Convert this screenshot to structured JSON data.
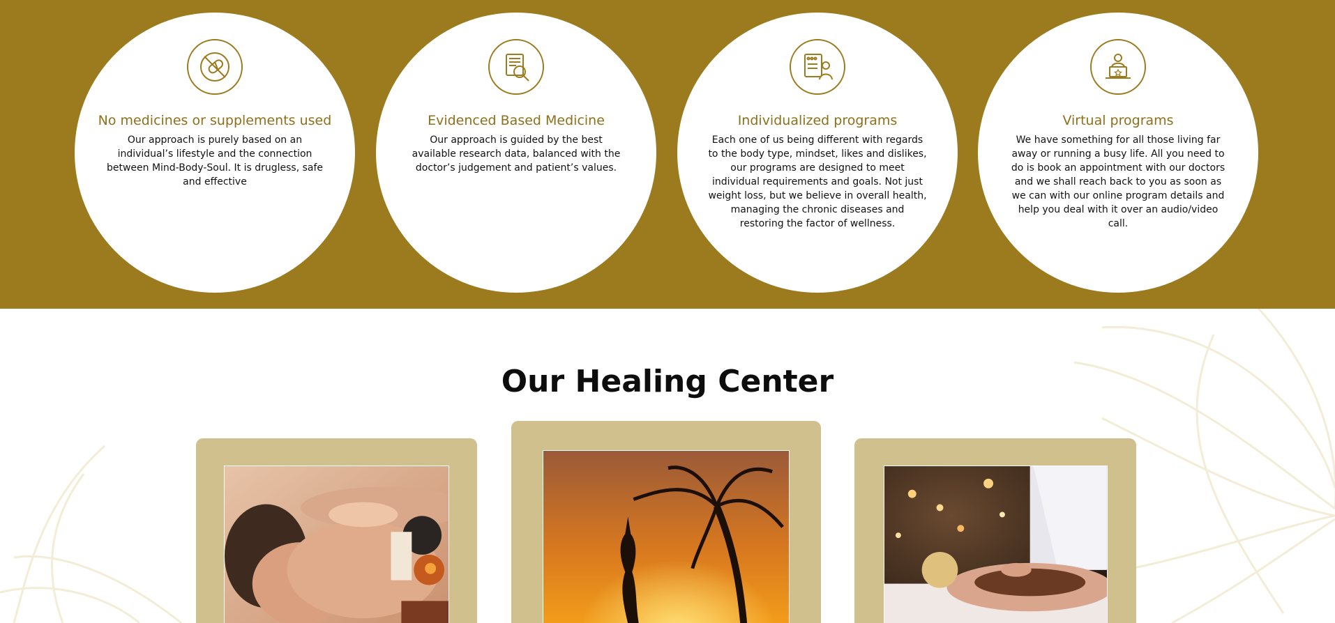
{
  "features": [
    {
      "title": "No medicines or supplements used",
      "text": "Our approach is purely based on an individual’s lifestyle and the connection between Mind-Body-Soul. It is drugless, safe and effective",
      "icon": "no-pills-icon"
    },
    {
      "title": "Evidenced Based Medicine",
      "text": "Our approach is guided by the best available research data, balanced with the doctor’s judgement and patient’s values.",
      "icon": "research-document-icon"
    },
    {
      "title": "Individualized programs",
      "text": "Each one of us being different with regards to the body type, mindset, likes and dislikes, our programs are designed to meet individual requirements and goals. Not just weight loss, but we believe in overall health, managing the chronic diseases and restoring the factor of wellness.",
      "icon": "doctor-chart-icon"
    },
    {
      "title": "Virtual programs",
      "text": "We have something for all those living far away or running a busy life. All you need to do is book an appointment with our doctors and we shall reach back to you as soon as we can with our online program details and help you deal with it over an audio/video call.",
      "icon": "online-doctor-icon"
    }
  ],
  "healing_center": {
    "title": "Our Healing Center",
    "cards": [
      {
        "image": "man-massage-photo"
      },
      {
        "image": "yoga-sunset-photo"
      },
      {
        "image": "back-treatment-photo"
      }
    ]
  },
  "colors": {
    "brand_gold": "#9b7b1e",
    "card_tan": "#cfc08e",
    "title_gold": "#8f6f19"
  }
}
